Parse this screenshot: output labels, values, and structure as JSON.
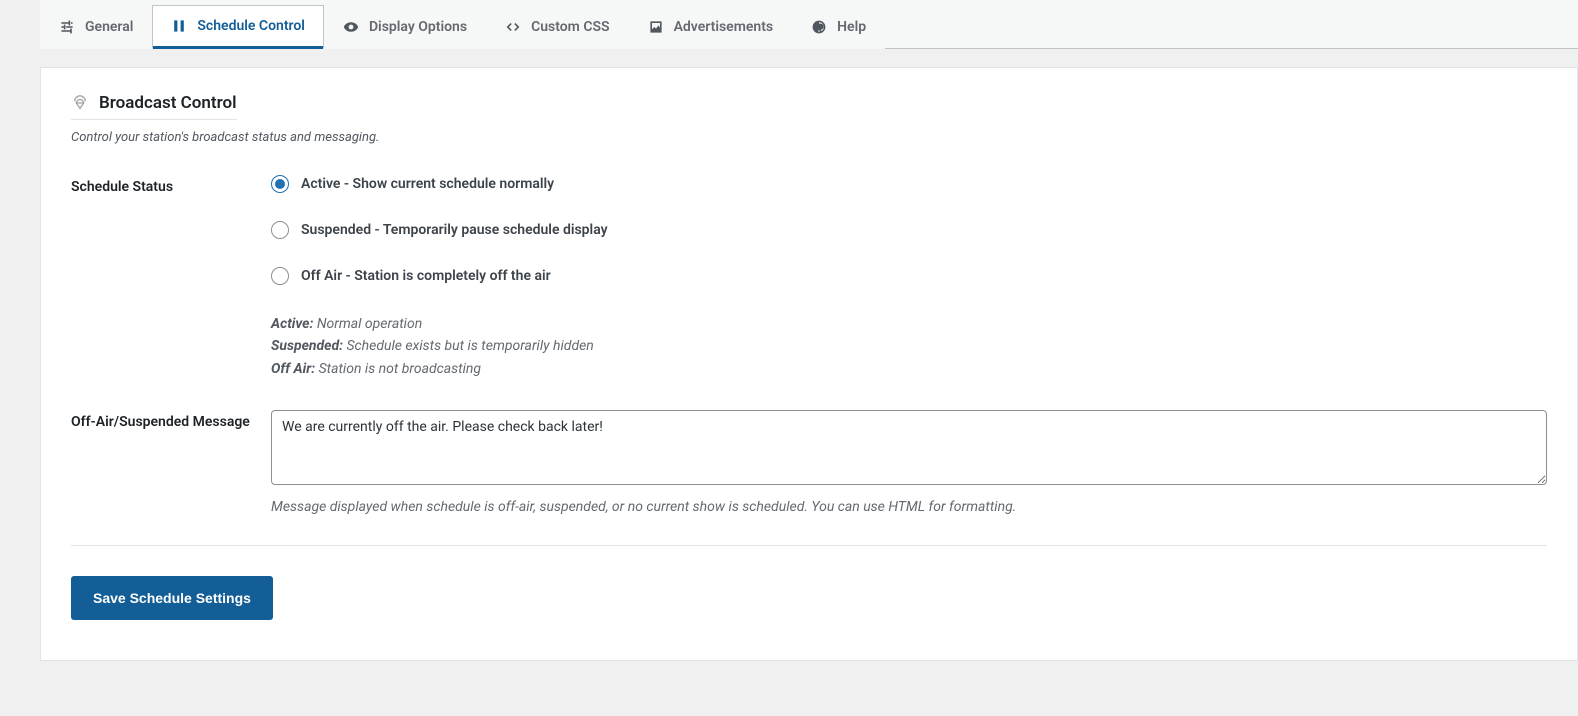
{
  "tabs": [
    {
      "label": "General",
      "active": false
    },
    {
      "label": "Schedule Control",
      "active": true
    },
    {
      "label": "Display Options",
      "active": false
    },
    {
      "label": "Custom CSS",
      "active": false
    },
    {
      "label": "Advertisements",
      "active": false
    },
    {
      "label": "Help",
      "active": false
    }
  ],
  "section": {
    "title": "Broadcast Control",
    "subtitle": "Control your station's broadcast status and messaging."
  },
  "schedule_status": {
    "label": "Schedule Status",
    "options": [
      {
        "label": "Active - Show current schedule normally",
        "checked": true
      },
      {
        "label": "Suspended - Temporarily pause schedule display",
        "checked": false
      },
      {
        "label": "Off Air - Station is completely off the air",
        "checked": false
      }
    ],
    "desc": [
      {
        "term": "Active:",
        "text": " Normal operation"
      },
      {
        "term": "Suspended:",
        "text": " Schedule exists but is temporarily hidden"
      },
      {
        "term": "Off Air:",
        "text": " Station is not broadcasting"
      }
    ]
  },
  "message_field": {
    "label": "Off-Air/Suspended Message",
    "value": "We are currently off the air. Please check back later!",
    "hint": "Message displayed when schedule is off-air, suspended, or no current show is scheduled. You can use HTML for formatting."
  },
  "save_button": "Save Schedule Settings"
}
